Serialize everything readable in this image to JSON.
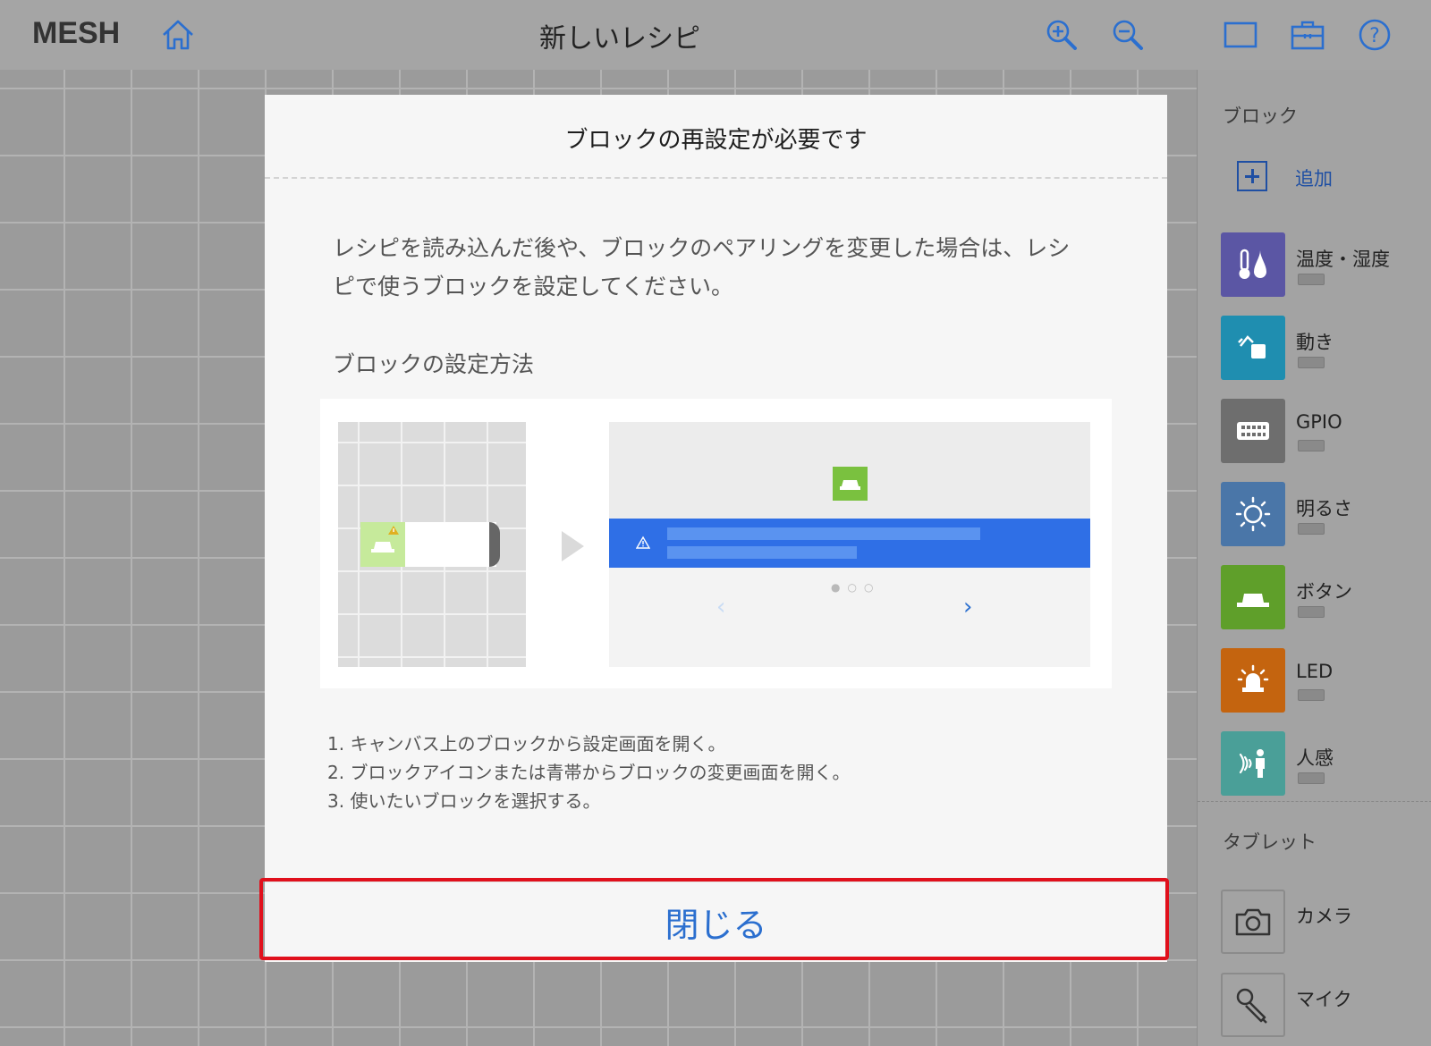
{
  "app": {
    "logo": "MESH",
    "title": "新しいレシピ"
  },
  "toolbar": {
    "home_icon": "home-icon",
    "zoom_in_icon": "zoom-in-icon",
    "zoom_out_icon": "zoom-out-icon",
    "screen_icon": "screen-icon",
    "toolbox_icon": "toolbox-icon",
    "help_icon": "help-icon",
    "icon_color": "#2b6fcf"
  },
  "panel": {
    "blocks_heading": "ブロック",
    "add_label": "追加",
    "blocks": [
      {
        "name": "温度・湿度",
        "color": "#5b56a4",
        "icon": "thermometer-drop-icon"
      },
      {
        "name": "動き",
        "color": "#1f8eb0",
        "icon": "motion-icon"
      },
      {
        "name": "GPIO",
        "color": "#6e6e6e",
        "icon": "gpio-icon"
      },
      {
        "name": "明るさ",
        "color": "#4a76a8",
        "icon": "brightness-icon"
      },
      {
        "name": "ボタン",
        "color": "#5f9f2a",
        "icon": "button-icon"
      },
      {
        "name": "LED",
        "color": "#c4640f",
        "icon": "led-icon"
      },
      {
        "name": "人感",
        "color": "#4a9f98",
        "icon": "human-sensor-icon"
      }
    ],
    "tablet_heading": "タブレット",
    "tablet_items": [
      {
        "name": "カメラ",
        "icon": "camera-icon"
      },
      {
        "name": "マイク",
        "icon": "microphone-icon"
      }
    ]
  },
  "modal": {
    "title": "ブロックの再設定が必要です",
    "body_line1": "レシピを読み込んだ後や、ブロックのペアリングを変更した場合は、レシ",
    "body_line2": "ピで使うブロックを設定してください。",
    "subheading": "ブロックの設定方法",
    "steps": [
      "1.  キャンバス上のブロックから設定画面を開く。",
      "2.  ブロックアイコンまたは青帯からブロックの変更画面を開く。",
      "3.  使いたいブロックを選択する。"
    ],
    "close_label": "閉じる",
    "highlight_color": "#e0101c"
  }
}
